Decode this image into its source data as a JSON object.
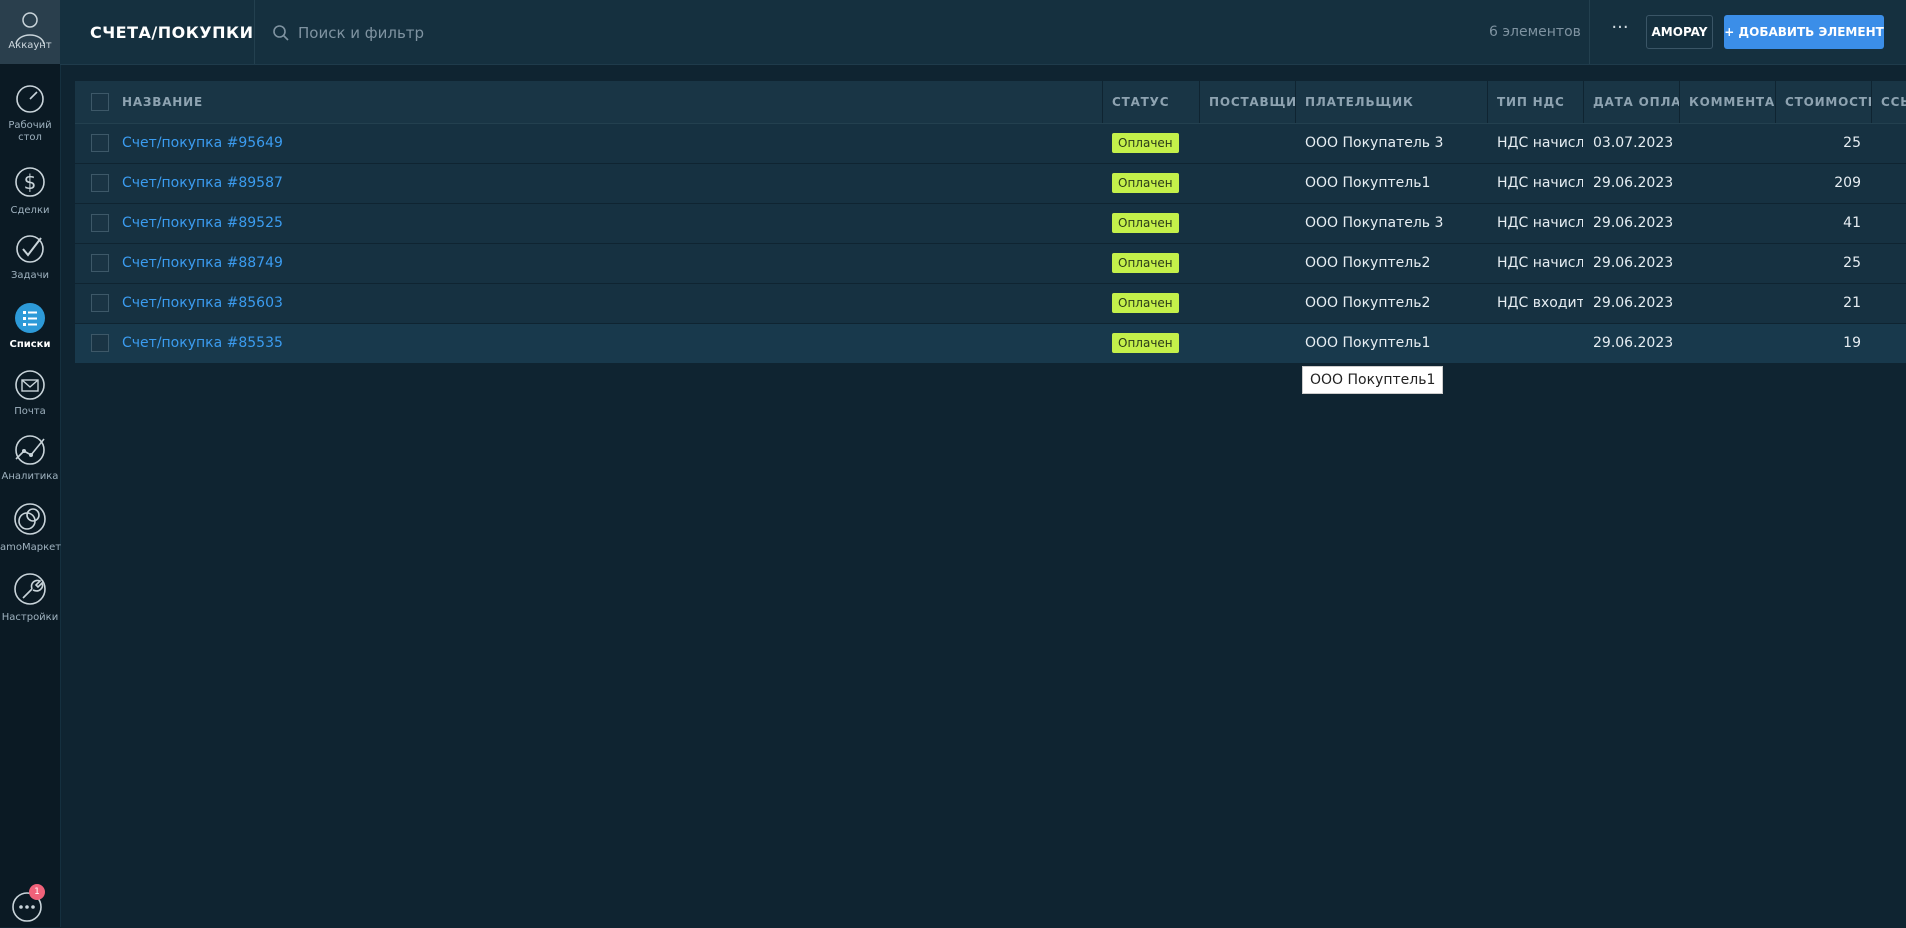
{
  "sidebar": {
    "account_label": "Аккаунт",
    "items": [
      {
        "label": "Рабочий стол",
        "icon": "dashboard-icon"
      },
      {
        "label": "Сделки",
        "icon": "dollar-icon"
      },
      {
        "label": "Задачи",
        "icon": "checkmark-icon"
      },
      {
        "label": "Списки",
        "icon": "lists-icon",
        "active": true
      },
      {
        "label": "Почта",
        "icon": "mail-icon"
      },
      {
        "label": "Аналитика",
        "icon": "analytics-icon"
      },
      {
        "label": "amoМаркет",
        "icon": "market-icon"
      },
      {
        "label": "Настройки",
        "icon": "wrench-icon"
      }
    ],
    "chat_badge": "1"
  },
  "header": {
    "title": "СЧЕТА/ПОКУПКИ",
    "search_placeholder": "Поиск и фильтр",
    "count": "6 элементов",
    "more": "···",
    "amopay": "AMOPAY",
    "add_button": "+ ДОБАВИТЬ ЭЛЕМЕНТ"
  },
  "table": {
    "columns": [
      "НАЗВАНИЕ",
      "СТАТУС",
      "ПОСТАВЩИК",
      "ПЛАТЕЛЬЩИК",
      "ТИП НДС",
      "ДАТА ОПЛАТЫ",
      "КОММЕНТАРИЙ",
      "СТОИМОСТЬ",
      "ССЫЛКА НА"
    ],
    "rows": [
      {
        "name": "Счет/покупка #95649",
        "status": "Оплачен",
        "supplier": "",
        "payer": "ООО Покупатель 3",
        "vat": "НДС начислен",
        "date": "03.07.2023",
        "comment": "",
        "cost": "25"
      },
      {
        "name": "Счет/покупка #89587",
        "status": "Оплачен",
        "supplier": "",
        "payer": "ООО Покуптель1",
        "vat": "НДС начислен",
        "date": "29.06.2023",
        "comment": "",
        "cost": "209"
      },
      {
        "name": "Счет/покупка #89525",
        "status": "Оплачен",
        "supplier": "",
        "payer": "ООО Покупатель 3",
        "vat": "НДС начислен",
        "date": "29.06.2023",
        "comment": "",
        "cost": "41"
      },
      {
        "name": "Счет/покупка #88749",
        "status": "Оплачен",
        "supplier": "",
        "payer": "ООО Покуптель2",
        "vat": "НДС начислен",
        "date": "29.06.2023",
        "comment": "",
        "cost": "25"
      },
      {
        "name": "Счет/покупка #85603",
        "status": "Оплачен",
        "supplier": "",
        "payer": "ООО Покуптель2",
        "vat": "НДС входит",
        "date": "29.06.2023",
        "comment": "",
        "cost": "21"
      },
      {
        "name": "Счет/покупка #85535",
        "status": "Оплачен",
        "supplier": "",
        "payer": "ООО Покуптель1",
        "vat": "",
        "date": "29.06.2023",
        "comment": "",
        "cost": "19"
      }
    ]
  },
  "tooltip": "ООО Покуптель1",
  "colors": {
    "accent": "#3b8ee8",
    "link": "#3b9cf0",
    "status_badge": "#c4f04a"
  }
}
